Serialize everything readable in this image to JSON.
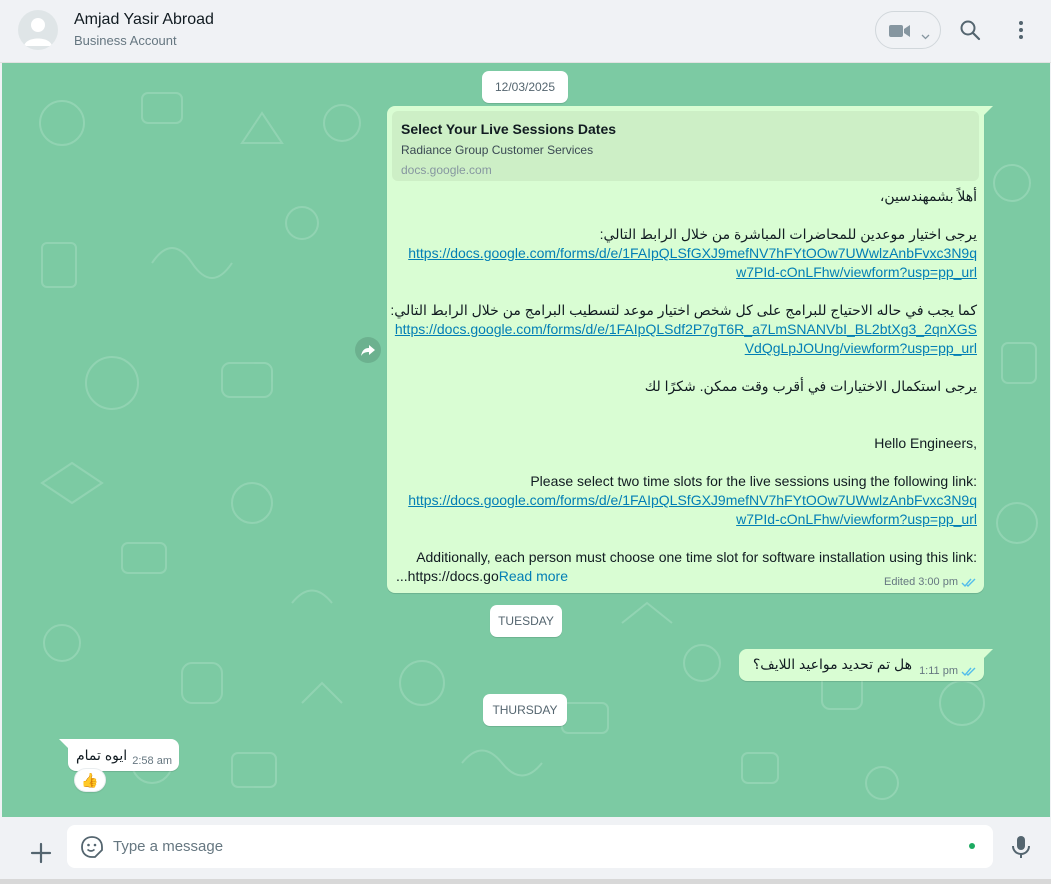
{
  "header": {
    "contact_name": "Amjad Yasir Abroad",
    "contact_subtitle": "Business Account",
    "icons": [
      "default-avatar-icon",
      "video-call-icon",
      "chevron-down-icon",
      "search-icon",
      "menu-icon"
    ]
  },
  "chat": {
    "date_1": "12/03/2025",
    "date_2": "TUESDAY",
    "date_3": "THURSDAY",
    "message_1": {
      "preview_title": "Select Your Live Sessions Dates",
      "preview_description": "Radiance Group Customer Services",
      "preview_domain": "docs.google.com",
      "line_1": "أهلاً بشمهندسين،",
      "line_2": "يرجى اختيار موعدين للمحاضرات المباشرة من خلال الرابط التالي:",
      "link_1a": "https://docs.google.com/forms/d/e/1FAIpQLSfGXJ9mefNV7hFYtOOw7UWwlzAnbFvxc3N9q",
      "link_1b": "w7PId-cOnLFhw/viewform?usp=pp_url",
      "line_3": "كما يجب في حاله الاحتياج للبرامج على كل شخص اختيار موعد لتسطيب  البرامج من خلال الرابط التالي:",
      "link_2a": "https://docs.google.com/forms/d/e/1FAIpQLSdf2P7gT6R_a7LmSNANVbI_BL2btXg3_2qnXGS",
      "link_2b": "VdQgLpJOUng/viewform?usp=pp_url",
      "line_4": "يرجى استكمال الاختيارات في أقرب وقت ممكن. شكرًا لك",
      "line_5": "Hello Engineers,",
      "line_6": "Please select two time slots for the live sessions using the following link:",
      "link_3a": "https://docs.google.com/forms/d/e/1FAIpQLSfGXJ9mefNV7hFYtOOw7UWwlzAnbFvxc3N9q",
      "link_3b": "w7PId-cOnLFhw/viewform?usp=pp_url",
      "line_7": "Additionally, each person must choose one time slot for software installation using this link:",
      "line_8_text": "...https://docs.go",
      "read_more": "Read more",
      "meta": "Edited 3:00 pm"
    },
    "message_2": {
      "text": "هل تم تحديد مواعيد اللايف؟",
      "time": "1:11 pm"
    },
    "message_3": {
      "text": "ايوه تمام",
      "time": "2:58 am",
      "reaction": "👍"
    }
  },
  "footer": {
    "placeholder": "Type a message",
    "icons": [
      "plus-icon",
      "sticker-icon",
      "microphone-icon"
    ]
  },
  "colors": {
    "chat_background": "#7ccaa3",
    "outgoing_bubble": "#d9fdd3",
    "link": "#027eb5",
    "read_ticks": "#53bdeb"
  }
}
